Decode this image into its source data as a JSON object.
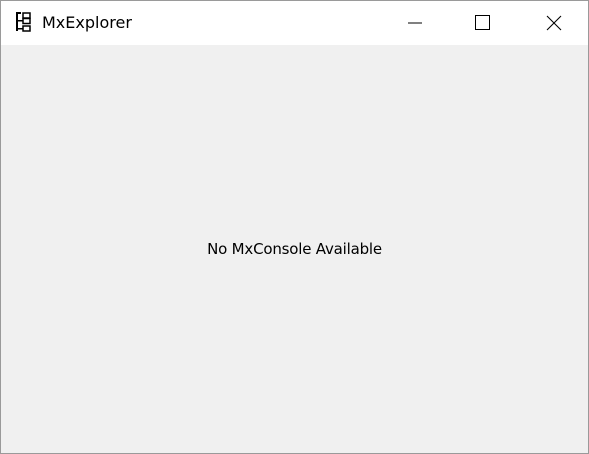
{
  "window": {
    "title": "MxExplorer",
    "icon": "tree-structure-icon"
  },
  "caption_buttons": {
    "minimize_icon": "minimize-icon",
    "maximize_icon": "maximize-icon",
    "close_icon": "close-icon"
  },
  "main": {
    "message": "No MxConsole Available"
  }
}
